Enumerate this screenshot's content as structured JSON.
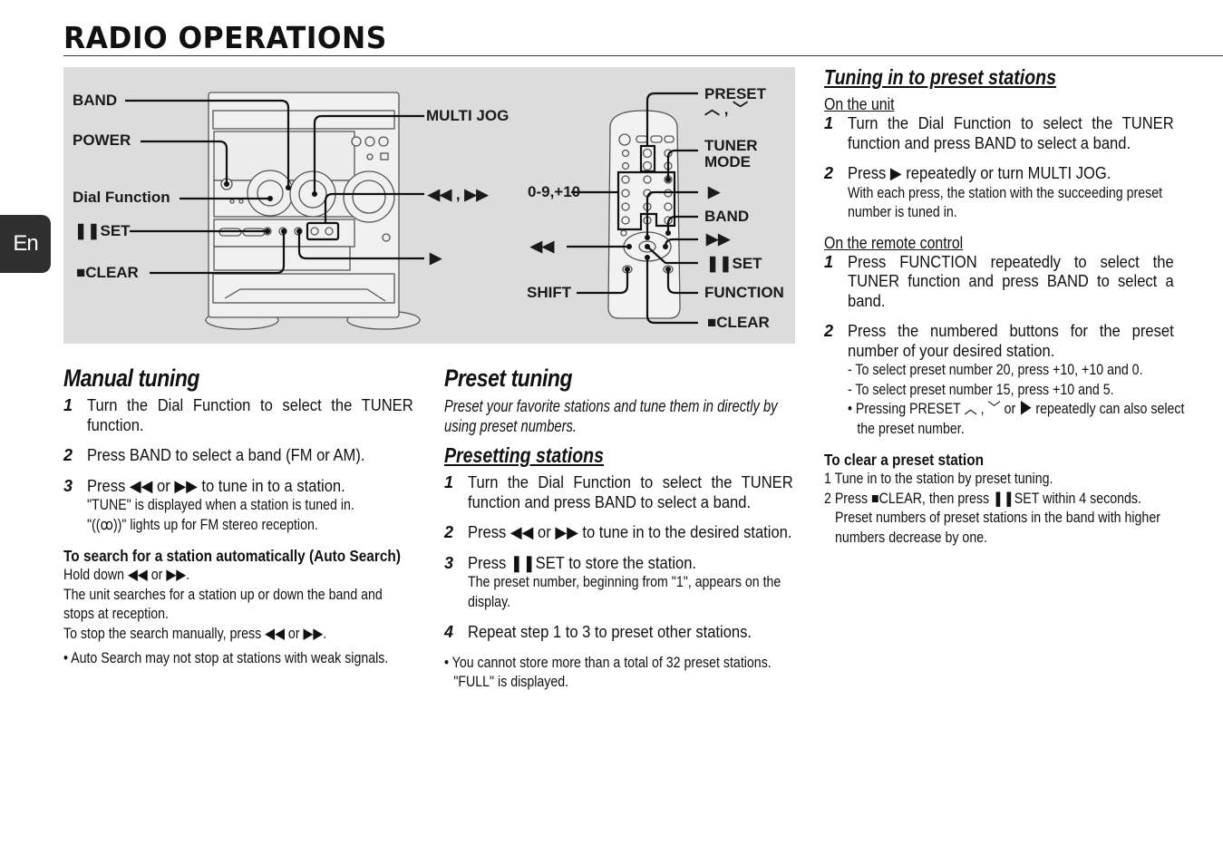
{
  "page": {
    "title": "RADIO OPERATIONS",
    "language_tab": "En"
  },
  "figure": {
    "unit_labels": {
      "band": "BAND",
      "power": "POWER",
      "dial_function": "Dial Function",
      "set": "SET",
      "clear": "CLEAR",
      "multi_jog": "MULTI JOG",
      "rew_ff": "◀◀ , ▶▶",
      "play": "▶"
    },
    "remote_labels": {
      "preset": "PRESET",
      "preset_arrows": "︿ , ﹀",
      "tuner_mode_1": "TUNER",
      "tuner_mode_2": "MODE",
      "numbers": "0-9,+10",
      "play": "▶",
      "band": "BAND",
      "rew": "◀◀",
      "ff": "▶▶",
      "set": "SET",
      "shift": "SHIFT",
      "function": "FUNCTION",
      "clear": "CLEAR"
    }
  },
  "manual_tuning": {
    "heading": "Manual tuning",
    "steps": [
      {
        "num": "1",
        "text": "Turn the Dial Function to select the TUNER function."
      },
      {
        "num": "2",
        "text": "Press BAND to select a band (FM or AM)."
      },
      {
        "num": "3",
        "text": "Press ◀◀ or ▶▶ to tune in to a station.",
        "notes": [
          "\"TUNE\" is displayed when a station is tuned in.",
          "\"((ꝏ))\" lights up for FM stereo reception."
        ]
      }
    ],
    "auto_search": {
      "heading": "To search for a station automatically (Auto Search)",
      "lines": [
        "Hold down ◀◀ or ▶▶.",
        "The unit searches for a station up or down the band and stops at reception.",
        "To stop the search manually, press ◀◀ or ▶▶."
      ],
      "bullet": "• Auto Search may not stop at stations with weak signals."
    }
  },
  "preset_tuning": {
    "heading": "Preset tuning",
    "intro": "Preset your favorite stations and tune them in directly by using preset numbers.",
    "presetting": {
      "heading": "Presetting stations",
      "steps": [
        {
          "num": "1",
          "text": "Turn the Dial Function to select the TUNER function and press BAND to select a band."
        },
        {
          "num": "2",
          "text": "Press ◀◀ or ▶▶ to tune in to the desired station."
        },
        {
          "num": "3",
          "text": "Press ❚❚SET to store the station.",
          "notes": [
            "The preset number, beginning from \"1\", appears on the display."
          ]
        },
        {
          "num": "4",
          "text": "Repeat step 1 to 3 to preset other stations."
        }
      ],
      "bullet_1": "• You cannot store more than a total of 32 preset stations.",
      "bullet_2": "\"FULL\" is displayed."
    }
  },
  "tuning_preset": {
    "heading": "Tuning in to preset stations",
    "on_unit": {
      "label": "On the unit",
      "steps": [
        {
          "num": "1",
          "text": "Turn the Dial Function to select the TUNER function and press BAND to select a band."
        },
        {
          "num": "2",
          "text": "Press ▶ repeatedly or turn MULTI JOG.",
          "notes": [
            "With each press, the station with the succeeding preset number is tuned in."
          ]
        }
      ]
    },
    "on_remote": {
      "label": "On the remote control",
      "steps": [
        {
          "num": "1",
          "text": "Press FUNCTION repeatedly to select the TUNER function and press BAND to select a band."
        },
        {
          "num": "2",
          "text": "Press the numbered buttons for the preset number of your desired station.",
          "notes": [
            "- To select preset number 20, press +10, +10 and 0.",
            "- To select preset number 15, press +10 and 5.",
            "• Pressing PRESET ︿ , ﹀ or ▶ repeatedly can also select the preset number."
          ]
        }
      ]
    },
    "clear": {
      "heading": "To clear a preset station",
      "lines": [
        "1 Tune in to the station by preset tuning.",
        "2 Press ■CLEAR, then press ❚❚SET within 4 seconds.",
        "Preset numbers of preset stations in the band with higher numbers decrease by one."
      ]
    }
  }
}
